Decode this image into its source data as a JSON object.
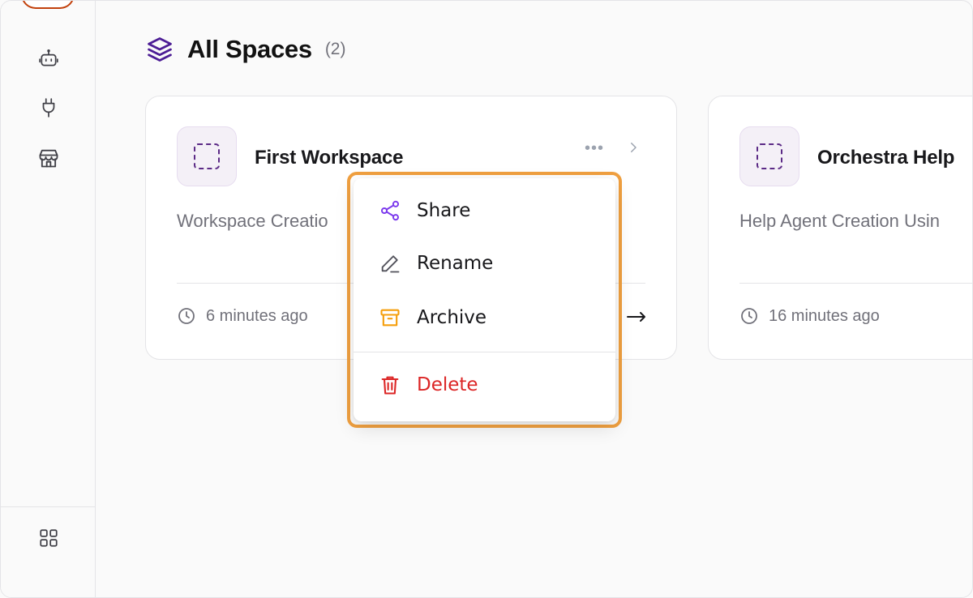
{
  "header": {
    "title": "All Spaces",
    "count": "(2)"
  },
  "sidebar": {
    "items": [
      {
        "icon": "bot-icon"
      },
      {
        "icon": "plug-icon"
      },
      {
        "icon": "store-icon"
      }
    ],
    "bottom_icon": "grid-icon"
  },
  "cards": [
    {
      "title": "First Workspace",
      "description": "Workspace Creatio",
      "time": "6 minutes ago"
    },
    {
      "title": "Orchestra Help",
      "description": "Help Agent Creation Usin",
      "time": "16 minutes ago"
    }
  ],
  "menu": {
    "items": [
      {
        "label": "Share",
        "icon": "share-icon",
        "color": "#7c3aed"
      },
      {
        "label": "Rename",
        "icon": "pencil-icon",
        "color": "#52525b"
      },
      {
        "label": "Archive",
        "icon": "archive-icon",
        "color": "#f59e0b"
      },
      {
        "label": "Delete",
        "icon": "trash-icon",
        "color": "#dc2626"
      }
    ]
  },
  "colors": {
    "accent": "#5b2a86",
    "highlight": "#f0a040",
    "danger": "#dc2626"
  }
}
